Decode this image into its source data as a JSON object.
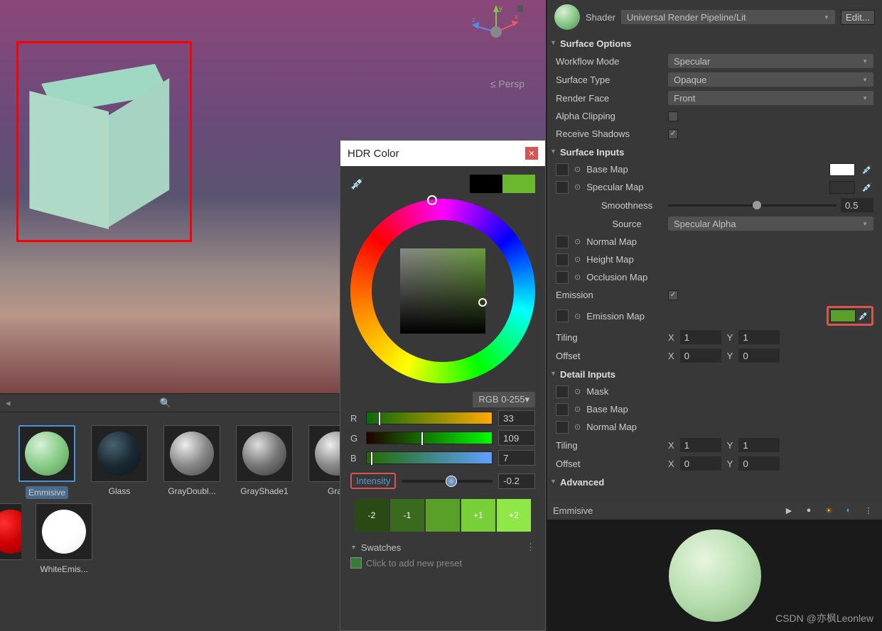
{
  "scene": {
    "projection": "Persp",
    "axes": [
      "x",
      "y",
      "z"
    ]
  },
  "project": {
    "thumbs": [
      {
        "label": "Emmisive",
        "color": "radial-gradient(circle at 35% 30%,#d8f0d8,#88cc88,#559955)",
        "selected": true
      },
      {
        "label": "Glass",
        "color": "radial-gradient(circle at 35% 30%,#4a6070,#1a2a32,#0a1418)"
      },
      {
        "label": "GrayDoubl...",
        "color": "radial-gradient(circle at 35% 30%,#eee,#888,#444)"
      },
      {
        "label": "GrayShade1",
        "color": "radial-gradient(circle at 35% 30%,#ddd,#777,#333)"
      },
      {
        "label": "Gray",
        "color": "radial-gradient(circle at 35% 30%,#eee,#888,#444)"
      },
      {
        "label": "WhiteEmis...",
        "color": "radial-gradient(circle at 35% 30%,#fff,#fff,#eee)"
      }
    ],
    "red_thumb": "radial-gradient(circle at 35% 30%,#ff3030,#cc0000,#880000)"
  },
  "picker": {
    "title": "HDR Color",
    "old_color": "#000000",
    "new_color": "#6bb82e",
    "mode": "RGB 0-255",
    "r": {
      "label": "R",
      "value": "33",
      "pos": "9%",
      "grad": "linear-gradient(to right,#0a6a0a,#ffaa00)"
    },
    "g": {
      "label": "G",
      "value": "109",
      "pos": "43%",
      "grad": "linear-gradient(to right,#200000,#00ff00)"
    },
    "b": {
      "label": "B",
      "value": "7",
      "pos": "3%",
      "grad": "linear-gradient(to right,#206b00,#60a0ff)"
    },
    "intensity": {
      "label": "Intensity",
      "value": "-0.2",
      "pos": "48%"
    },
    "int_buttons": [
      {
        "label": "-2",
        "bg": "#2a4a15"
      },
      {
        "label": "-1",
        "bg": "#3a6a1e"
      },
      {
        "label": "",
        "bg": "#58a028"
      },
      {
        "label": "+1",
        "bg": "#78d038"
      },
      {
        "label": "+2",
        "bg": "#90e848"
      }
    ],
    "swatches_label": "Swatches",
    "preset_hint": "Click to add new preset"
  },
  "inspector": {
    "shader_label": "Shader",
    "shader_value": "Universal Render Pipeline/Lit",
    "edit_btn": "Edit...",
    "sections": {
      "surface_options": "Surface Options",
      "surface_inputs": "Surface Inputs",
      "detail_inputs": "Detail Inputs",
      "advanced": "Advanced"
    },
    "workflow_mode": {
      "label": "Workflow Mode",
      "value": "Specular"
    },
    "surface_type": {
      "label": "Surface Type",
      "value": "Opaque"
    },
    "render_face": {
      "label": "Render Face",
      "value": "Front"
    },
    "alpha_clipping": {
      "label": "Alpha Clipping",
      "checked": false
    },
    "receive_shadows": {
      "label": "Receive Shadows",
      "checked": true
    },
    "base_map": {
      "label": "Base Map",
      "color": "#ffffff"
    },
    "specular_map": {
      "label": "Specular Map",
      "color": "#333333"
    },
    "smoothness": {
      "label": "Smoothness",
      "value": "0.5"
    },
    "source": {
      "label": "Source",
      "value": "Specular Alpha"
    },
    "normal_map": "Normal Map",
    "height_map": "Height Map",
    "occlusion_map": "Occlusion Map",
    "emission": {
      "label": "Emission",
      "checked": true
    },
    "emission_map": {
      "label": "Emission Map",
      "color": "#58a028"
    },
    "tiling": {
      "label": "Tiling",
      "x": "1",
      "y": "1"
    },
    "offset": {
      "label": "Offset",
      "x": "0",
      "y": "0"
    },
    "detail_mask": "Mask",
    "detail_base_map": "Base Map",
    "detail_normal_map": "Normal Map",
    "detail_tiling": {
      "label": "Tiling",
      "x": "1",
      "y": "1"
    },
    "detail_offset": {
      "label": "Offset",
      "x": "0",
      "y": "0"
    },
    "preview_name": "Emmisive",
    "axis_x": "X",
    "axis_y": "Y"
  },
  "watermark": "CSDN @亦枫Leonlew"
}
